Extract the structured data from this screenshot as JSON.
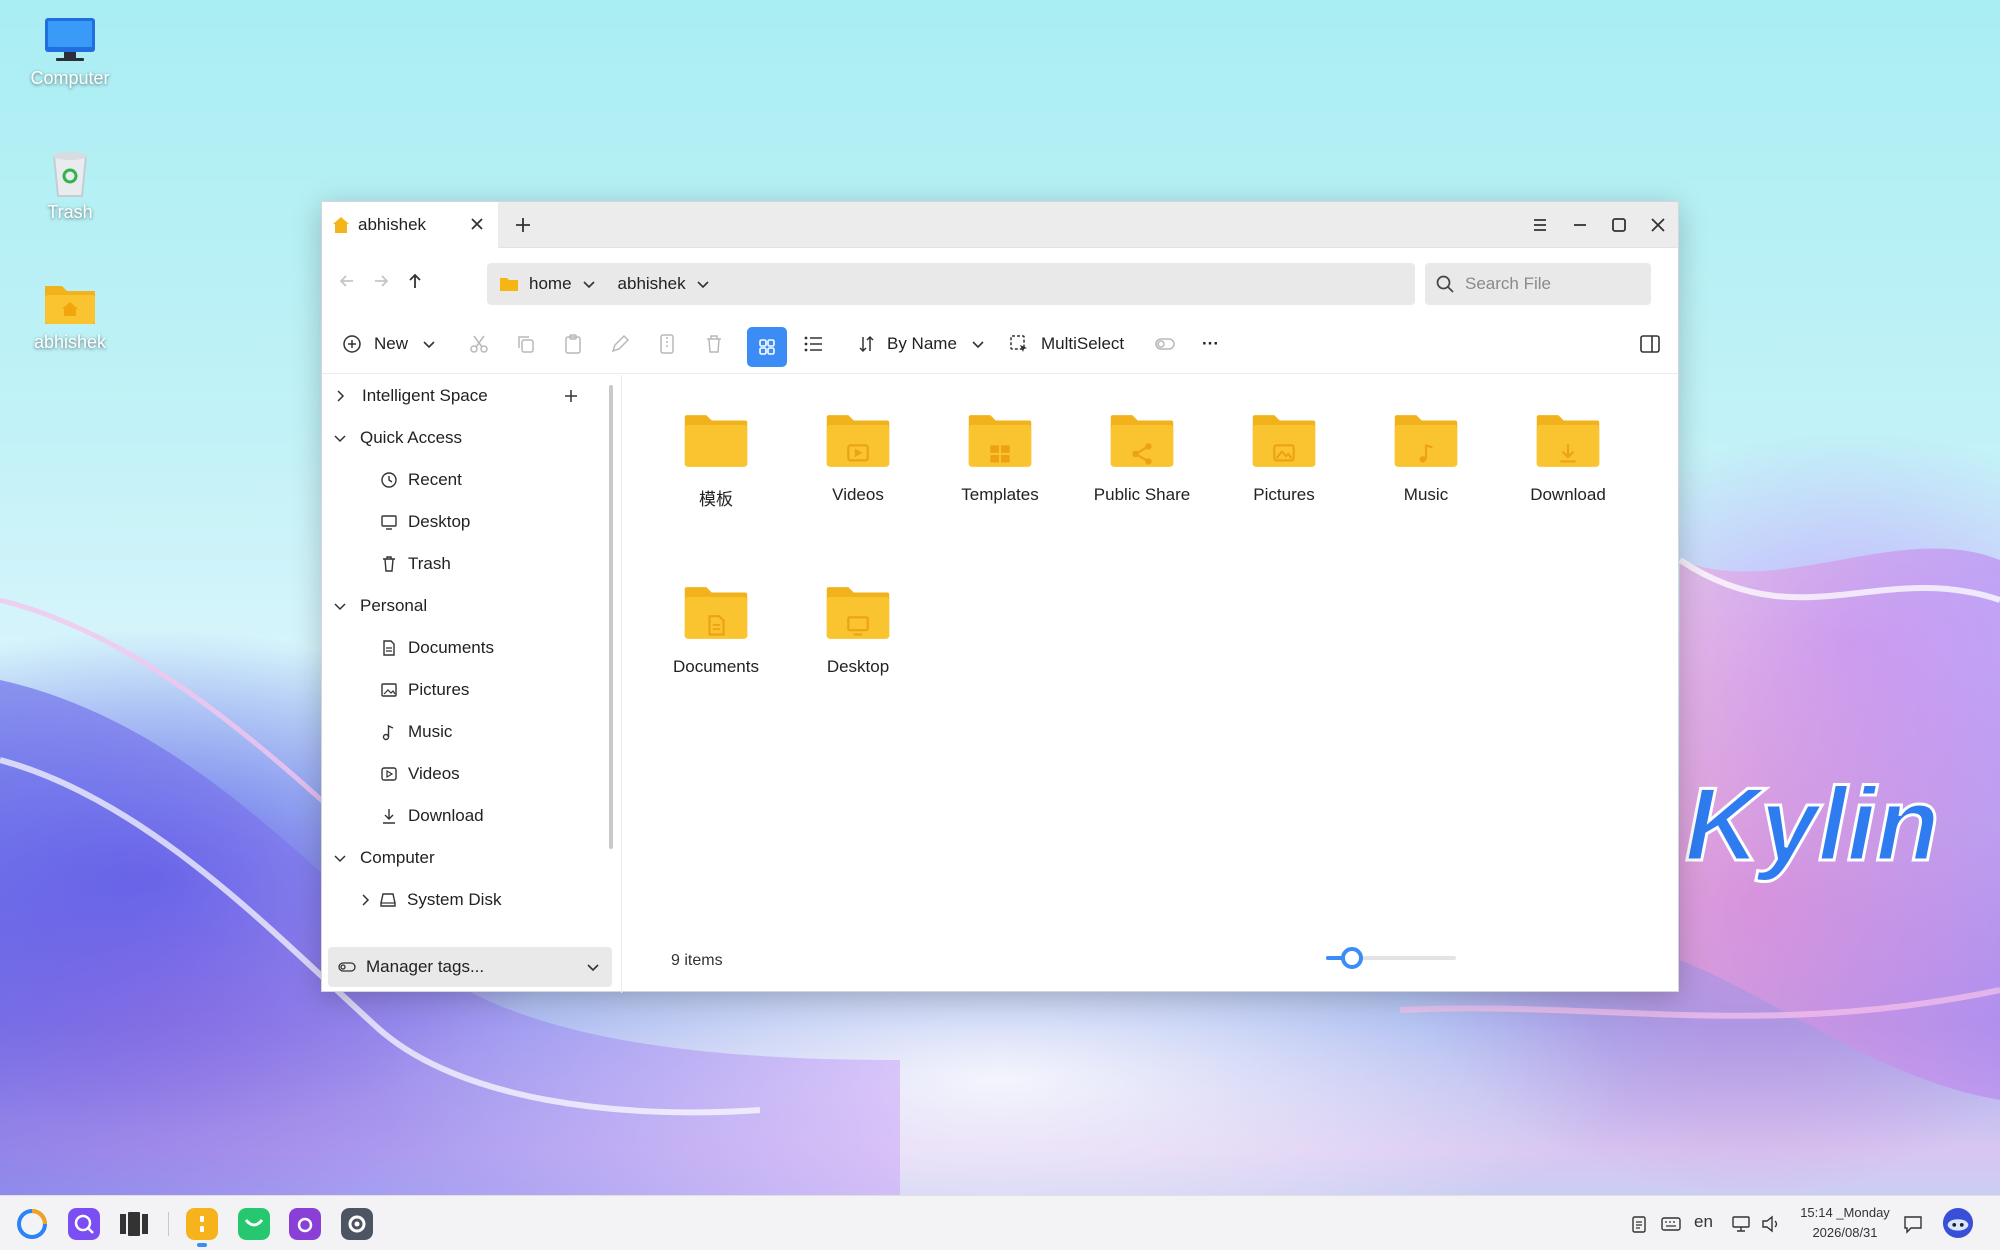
{
  "desktop": {
    "icons": [
      {
        "label": "Computer",
        "icon": "monitor-icon"
      },
      {
        "label": "Trash",
        "icon": "trash-bin-icon"
      },
      {
        "label": "abhishek",
        "icon": "home-folder-icon"
      }
    ],
    "wallpaper_text": "Kylin"
  },
  "window": {
    "tab": {
      "title": "abhishek",
      "icon": "home-icon"
    },
    "controls": {
      "menu": "menu-icon",
      "minimize": "minimize-icon",
      "maximize": "maximize-icon",
      "close": "close-icon"
    },
    "breadcrumb": [
      "home",
      "abhishek"
    ],
    "search": {
      "placeholder": "Search File",
      "value": ""
    },
    "toolbar": {
      "new_label": "New",
      "sort_label": "By Name",
      "multiselect_label": "MultiSelect",
      "view_mode": "icon-view",
      "more": "···"
    },
    "sidebar": {
      "intelligent_space": "Intelligent Space",
      "quick_access": {
        "label": "Quick Access",
        "items": [
          "Recent",
          "Desktop",
          "Trash"
        ]
      },
      "personal": {
        "label": "Personal",
        "items": [
          "Documents",
          "Pictures",
          "Music",
          "Videos",
          "Download"
        ]
      },
      "computer": {
        "label": "Computer",
        "items": [
          "System Disk"
        ]
      },
      "tags_label": "Manager tags..."
    },
    "files": [
      {
        "name": "模板",
        "icon": "folder-icon"
      },
      {
        "name": "Videos",
        "icon": "video-folder-icon"
      },
      {
        "name": "Templates",
        "icon": "templates-folder-icon"
      },
      {
        "name": "Public Share",
        "icon": "share-folder-icon"
      },
      {
        "name": "Pictures",
        "icon": "pictures-folder-icon"
      },
      {
        "name": "Music",
        "icon": "music-folder-icon"
      },
      {
        "name": "Download",
        "icon": "download-folder-icon"
      },
      {
        "name": "Documents",
        "icon": "documents-folder-icon"
      },
      {
        "name": "Desktop",
        "icon": "desktop-folder-icon"
      }
    ],
    "status": {
      "item_count": "9 items",
      "zoom_level": 0.2
    }
  },
  "taskbar": {
    "clock_time": "15:14 _Monday",
    "clock_date": "2026/08/31",
    "input_lang": "en"
  },
  "colors": {
    "accent": "#3b8cf5",
    "folder": "#f9c430",
    "folder_dark": "#f1b21b"
  }
}
